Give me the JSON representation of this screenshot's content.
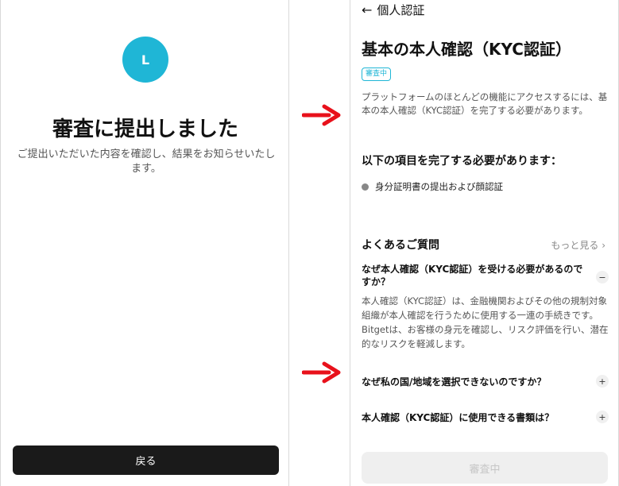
{
  "left_screen": {
    "avatar_letter": "L",
    "title": "審査に提出しました",
    "description": "ご提出いただいた内容を確認し、結果をお知らせいたします。",
    "back_button": "戻る"
  },
  "right_screen": {
    "header": {
      "back_icon": "←",
      "title": "個人認証"
    },
    "kyc_title": "基本の本人確認（KYC認証）",
    "status_badge": "審査中",
    "description": "プラットフォームのほとんどの機能にアクセスするには、基本の本人確認（KYC認証）を完了する必要があります。",
    "requirements_heading": "以下の項目を完了する必要があります：",
    "requirement_item": "身分証明書の提出および顔認証",
    "faq": {
      "heading": "よくあるご質問",
      "more": "もっと見る ›",
      "items": [
        {
          "question": "なぜ本人確認（KYC認証）を受ける必要があるのですか？",
          "answer": "本人確認（KYC認証）は、金融機関およびその他の規制対象組織が本人確認を行うために使用する一連の手続きです。Bitgetは、お客様の身元を確認し、リスク評価を行い、潜在的なリスクを軽減します。",
          "toggle": "−"
        },
        {
          "question": "なぜ私の国/地域を選択できないのですか？",
          "toggle": "+"
        },
        {
          "question": "本人確認（KYC認証）に使用できる書類は？",
          "toggle": "+"
        }
      ]
    },
    "bottom_button": "審査中"
  },
  "colors": {
    "accent": "#1fb6d6",
    "arrow": "#e8111b",
    "primary_button": "#1a1a1a"
  }
}
